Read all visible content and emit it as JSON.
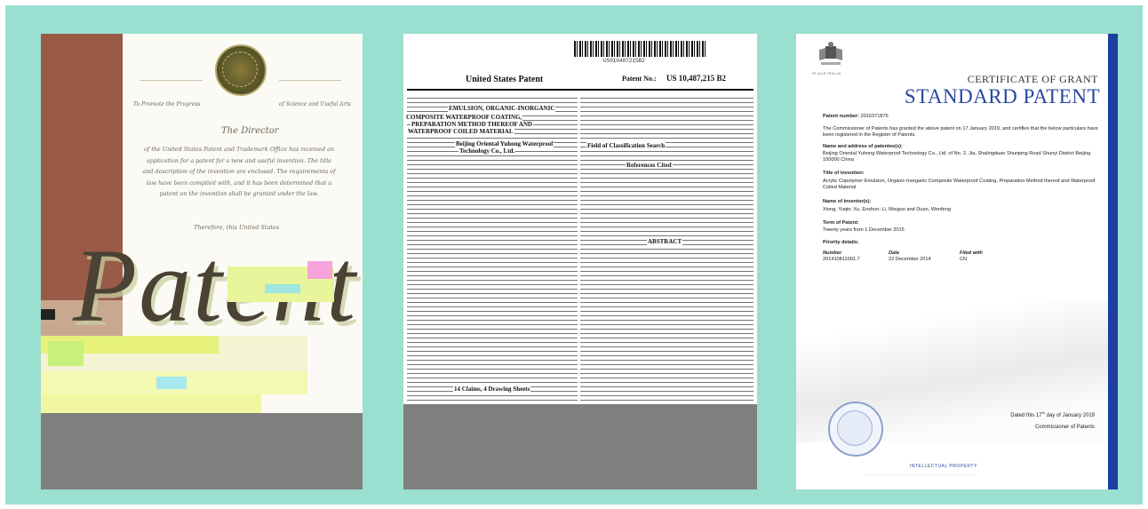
{
  "us_certificate": {
    "patent_word": "Patent",
    "header_left": "To Promote the Progress",
    "header_right": "of Science and Useful Arts",
    "director_line": "The Director",
    "body_text": "of the United States Patent and Trademark Office has received an application for a patent for a new and useful invention. The title and description of the invention are enclosed. The requirements of law have been complied with, and it has been determined that a patent on the invention shall be granted under the law.",
    "closing": "Therefore, this United States"
  },
  "us_patent": {
    "barcode_number": "US010487215B2",
    "office": "United States Patent",
    "patent_label": "Patent No.:",
    "patent_number": "US 10,487,215 B2",
    "field_label": "Field of Classification Search",
    "references_label": "References Cited",
    "abstract_label": "ABSTRACT",
    "claims_label": "14 Claims, 4 Drawing Sheets",
    "title_fragment_1": "COMPOSITE WATERPROOF COATING,",
    "title_fragment_2": "PREPARATION METHOD THEREOF AND",
    "title_fragment_3": "WATERPROOF COILED MATERIAL",
    "assignee_fragment": "Beijing Oriental Yuhong Waterproof",
    "assignee_fragment_2": "Technology Co., Ltd.",
    "emulsion_fragment": "EMULSION, ORGANIC-INORGANIC"
  },
  "au_certificate": {
    "kicker": "CERTIFICATE OF GRANT",
    "title": "STANDARD PATENT",
    "patent_number_label": "Patent number:",
    "patent_number": "2015371876",
    "intro": "The Commissioner of Patents has granted the above patent on 17 January 2019, and certifies that the below particulars have been registered in the Register of Patents.",
    "patentee_label": "Name and address of patentee(s):",
    "patentee": "Beijing Oriental Yuhong Waterproof Technology Co., Ltd. of No. 2, Jia, Shalingduan  Shunping Road Shunyi District Beijing 100000 China",
    "invention_label": "Title of invention:",
    "invention": "Acrylic Copolymer Emulsion, Organic-Inorganic Composite Waterproof Coating, Preparation Method thereof and Waterproof Coiled Material",
    "inventors_label": "Name of inventor(s):",
    "inventors": "Xiong, Yuqin; Xu, Enshun; Li, Weiguo and Duan, Wenfeng",
    "term_label": "Term of Patent:",
    "term": "Twenty years from 1 December 2015",
    "priority_label": "Priority details:",
    "priority_headers": [
      "Number",
      "Date",
      "Filed with"
    ],
    "priority_row": [
      "201410811091.7",
      "22 December 2014",
      "CN"
    ],
    "dated_prefix": "Dated this 17",
    "dated_sup": "th",
    "dated_suffix": " day of January 2019",
    "signatory": "Commissioner of Patents",
    "footer_blue": "INTELLECTUAL PROPERTY",
    "crest_caption": "IP AUSTRALIA"
  },
  "colors": {
    "background": "#9bdfd0",
    "au_blue": "#1c3f9e",
    "us_band": "#9a5a48",
    "placeholder_grey": "#7f7f7f"
  }
}
